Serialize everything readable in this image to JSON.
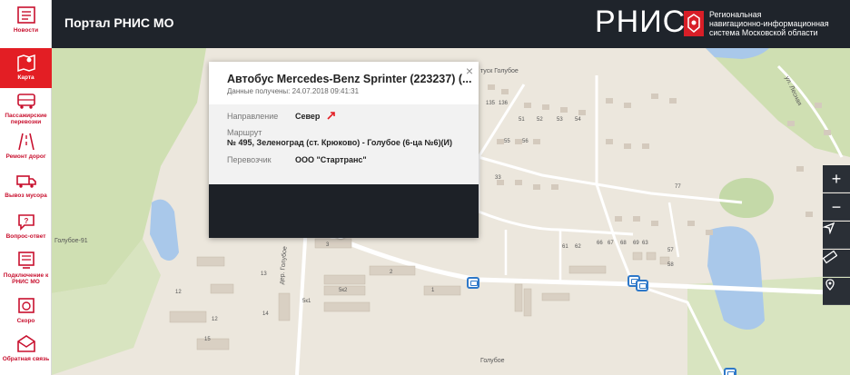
{
  "sidebar": {
    "items": [
      {
        "label": "Новости",
        "icon": "news-icon"
      },
      {
        "label": "Карта",
        "icon": "map-icon",
        "active": true
      },
      {
        "label": "Пассажирские перевозки",
        "icon": "bus-icon"
      },
      {
        "label": "Ремонт дорог",
        "icon": "road-icon"
      },
      {
        "label": "Вывоз мусора",
        "icon": "truck-icon"
      },
      {
        "label": "Вопрос-ответ",
        "icon": "question-icon"
      },
      {
        "label": "Подключение к РНИС МО",
        "icon": "connect-icon"
      },
      {
        "label": "Скоро",
        "icon": "soon-icon"
      },
      {
        "label": "Обратная связь",
        "icon": "mail-icon"
      }
    ]
  },
  "header": {
    "title": "Портал РНИС МО",
    "logo_word": "РНИС",
    "logo_line1": "Региональная",
    "logo_line2": "навигационно-информационная",
    "logo_line3": "система Московской области"
  },
  "popup": {
    "title": "Автобус Mercedes-Benz Sprinter (223237)  (...",
    "received": "Данные получены: 24.07.2018 09:41:31",
    "direction_label": "Направление",
    "direction_value": "Север",
    "route_label": "Маршрут",
    "route_value": "№ 495, Зеленоград (ст. Крюково) - Голубое (6-ца №6)(И)",
    "carrier_label": "Перевозчик",
    "carrier_value": "ООО \"Стартранс\"",
    "close": "×"
  },
  "map": {
    "labels": {
      "golubye91": "Голубое-91",
      "golubye": "Голубое",
      "dep_golubye": "дер. Голубое",
      "lesnaya": "ул. Лесная",
      "tupik": "туск Голубое"
    },
    "buildings": [
      "135",
      "136",
      "51",
      "52",
      "53",
      "54",
      "55",
      "56",
      "33",
      "3A",
      "3",
      "2",
      "1",
      "5к2",
      "5к1",
      "12",
      "12",
      "13",
      "14",
      "15",
      "58",
      "57",
      "77",
      "63",
      "61",
      "62",
      "66",
      "67",
      "68",
      "69"
    ]
  },
  "controls": {
    "zoom_in": "+",
    "zoom_out": "−"
  }
}
